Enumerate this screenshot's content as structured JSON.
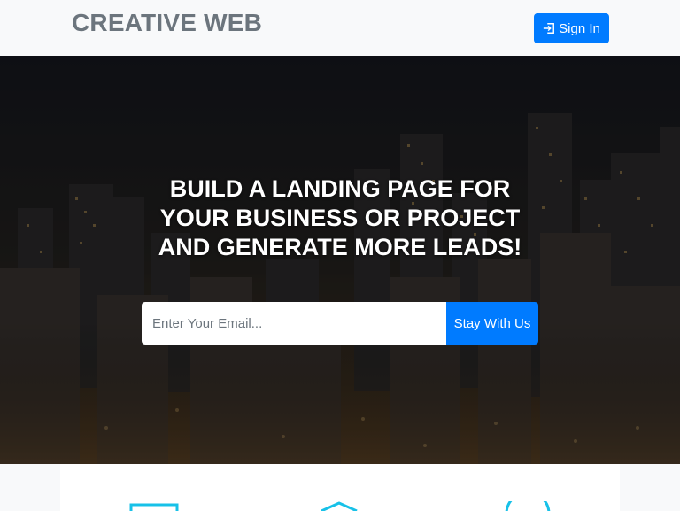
{
  "navbar": {
    "brand": "CREATIVE WEB",
    "signin_label": "Sign In",
    "signin_icon": "sign-in-icon"
  },
  "hero": {
    "headline_lines": [
      "BUILD A LANDING PAGE FOR",
      "YOUR BUSINESS OR PROJECT",
      "AND GENERATE MORE LEADS!"
    ],
    "email_placeholder": "Enter Your Email...",
    "email_value": "",
    "submit_label": "Stay With Us",
    "background": "city-skyline-at-dusk"
  },
  "features": {
    "icons": [
      "desktop-icon",
      "layers-icon",
      "check-circle-icon"
    ],
    "icon_color": "#17c1e8"
  },
  "colors": {
    "primary": "#007bff",
    "brand_text": "#6c757d",
    "nav_bg": "#f8f9fa",
    "hero_text": "#ffffff"
  }
}
